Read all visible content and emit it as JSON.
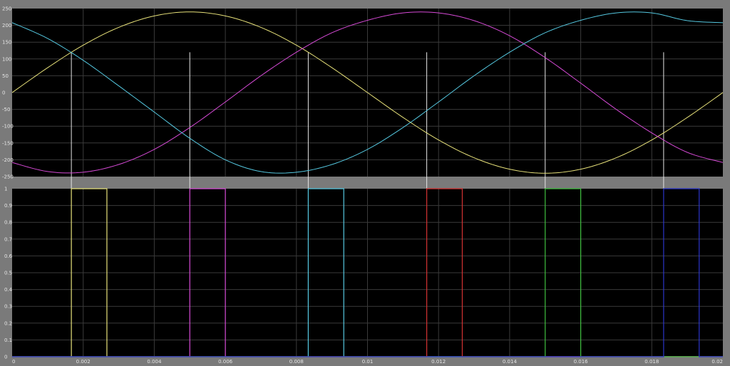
{
  "chart_data": [
    {
      "type": "line",
      "title": "",
      "xlabel": "",
      "ylabel": "",
      "xlim": [
        0,
        0.02
      ],
      "ylim": [
        -250,
        250
      ],
      "grid": true,
      "yticks": [
        "250",
        "200",
        "150",
        "100",
        "50",
        "0",
        "-50",
        "-100",
        "-150",
        "-200",
        "-250"
      ],
      "series": [
        {
          "color": "#e8e27a",
          "x": [
            0,
            0.001,
            0.002,
            0.003,
            0.004,
            0.005,
            0.006,
            0.007,
            0.008,
            0.009,
            0.01,
            0.011,
            0.012,
            0.013,
            0.014,
            0.015,
            0.016,
            0.017,
            0.018,
            0.019,
            0.02
          ],
          "y": [
            0,
            74,
            141,
            194,
            228,
            240,
            228,
            194,
            141,
            74,
            0,
            -74,
            -141,
            -194,
            -228,
            -240,
            -228,
            -194,
            -141,
            -74,
            0
          ]
        },
        {
          "color": "#d64ad6",
          "x": [
            0,
            0.001,
            0.002,
            0.003,
            0.004,
            0.005,
            0.006,
            0.007,
            0.008,
            0.009,
            0.01,
            0.011,
            0.012,
            0.013,
            0.014,
            0.015,
            0.016,
            0.017,
            0.018,
            0.019,
            0.02
          ],
          "y": [
            -208,
            -235,
            -237,
            -214,
            -169,
            -104,
            -28,
            50,
            120,
            178,
            215,
            237,
            237,
            214,
            169,
            104,
            28,
            -50,
            -120,
            -178,
            -208
          ]
        },
        {
          "color": "#55c8e0",
          "x": [
            0,
            0.001,
            0.002,
            0.003,
            0.004,
            0.005,
            0.006,
            0.007,
            0.008,
            0.009,
            0.01,
            0.011,
            0.012,
            0.013,
            0.014,
            0.015,
            0.016,
            0.017,
            0.018,
            0.019,
            0.02
          ],
          "y": [
            208,
            161,
            96,
            20,
            -58,
            -136,
            -200,
            -235,
            -237,
            -214,
            -169,
            -104,
            -28,
            50,
            120,
            178,
            215,
            237,
            237,
            214,
            208
          ]
        }
      ]
    },
    {
      "type": "line",
      "title": "",
      "xlabel": "",
      "ylabel": "",
      "xlim": [
        0,
        0.02
      ],
      "ylim": [
        0,
        1
      ],
      "grid": true,
      "yticks": [
        "1",
        "0.9",
        "0.8",
        "0.7",
        "0.6",
        "0.5",
        "0.4",
        "0.3",
        "0.2",
        "0.1",
        "0"
      ],
      "xticks": [
        "0",
        "0.002",
        "0.004",
        "0.006",
        "0.008",
        "0.01",
        "0.012",
        "0.014",
        "0.016",
        "0.018",
        "0.02"
      ],
      "pulses": [
        {
          "color": "#e8e27a",
          "start": 0.001667,
          "end": 0.002667
        },
        {
          "color": "#d64ad6",
          "start": 0.005,
          "end": 0.006
        },
        {
          "color": "#55c8e0",
          "start": 0.008333,
          "end": 0.009333
        },
        {
          "color": "#d33232",
          "start": 0.011667,
          "end": 0.012667
        },
        {
          "color": "#3fbf3f",
          "start": 0.015,
          "end": 0.016
        },
        {
          "color": "#2a35c8",
          "start": 0.018333,
          "end": 0.019333
        }
      ]
    }
  ],
  "crossings": [
    0.001667,
    0.005,
    0.008333,
    0.011667,
    0.015,
    0.018333
  ],
  "colors": {
    "background": "#000000",
    "frame": "#7a7a7a",
    "grid": "#3a3a3a",
    "marker": "#e6e6e6"
  }
}
